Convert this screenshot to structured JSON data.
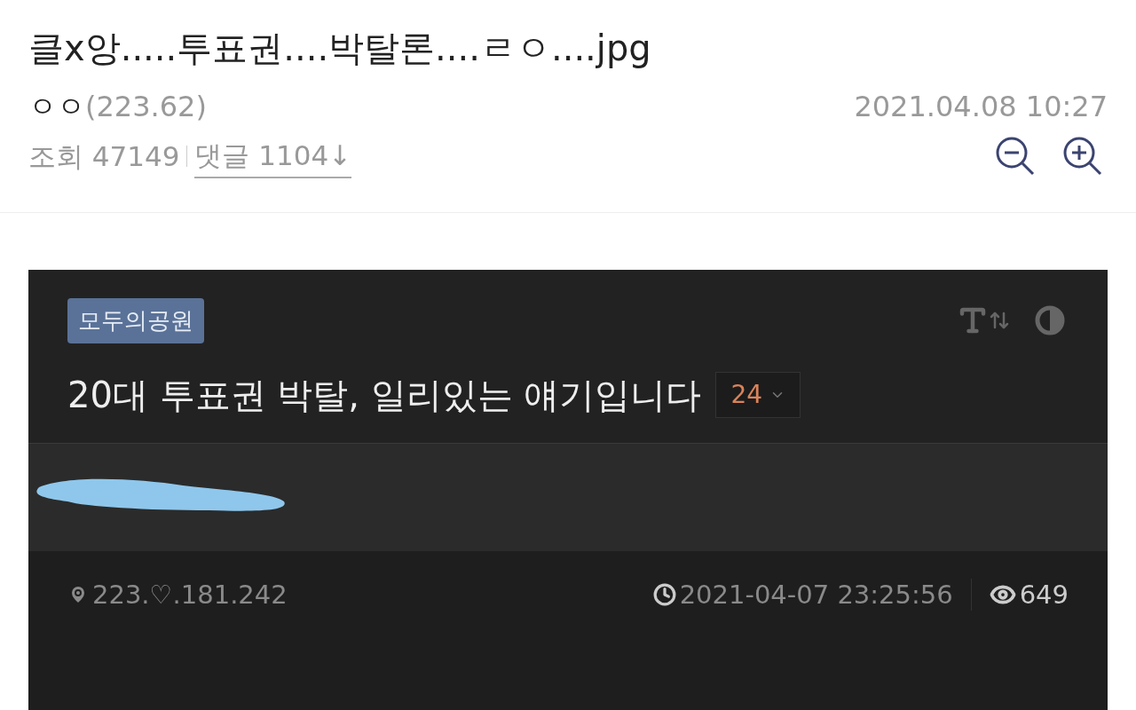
{
  "post": {
    "title": "클x앙.....투표권....박탈론....ㄹㅇ....jpg",
    "author": "ㅇㅇ",
    "author_ip": "(223.62)",
    "date": "2021.04.08 10:27",
    "views_label": "조회 47149",
    "comments_link": "댓글 1104↓"
  },
  "embedded": {
    "board_tag": "모두의공원",
    "title": "20대 투표권 박탈, 일리있는 얘기입니다",
    "comment_count": "24",
    "ip": "223.♡.181.242",
    "datetime": "2021-04-07 23:25:56",
    "views": "649"
  }
}
